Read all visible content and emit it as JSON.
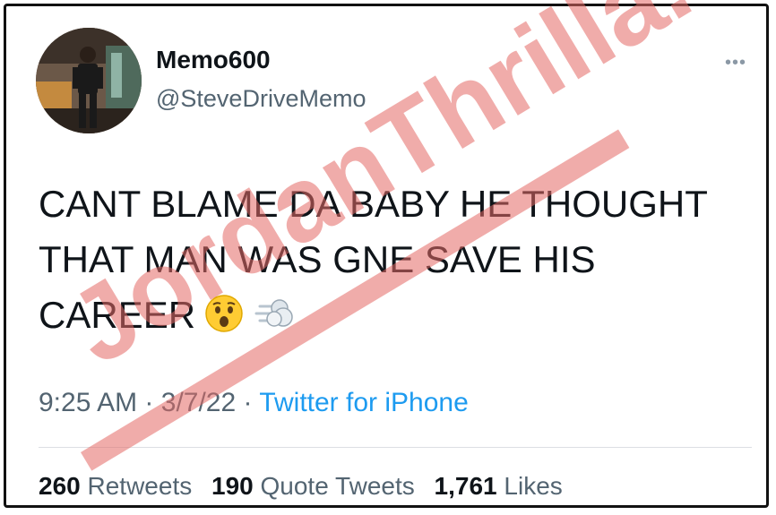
{
  "tweet": {
    "display_name": "Memo600",
    "handle": "@SteveDriveMemo",
    "more_icon": "more-horizontal-icon",
    "text_lines": [
      "CANT BLAME DA BABY HE THOUGHT",
      "THAT MAN WAS GNE SAVE HIS",
      "CAREER"
    ],
    "emojis": [
      "hushed-face-emoji",
      "dash-emoji"
    ],
    "time": "9:25 AM",
    "date": "3/7/22",
    "separator": "·",
    "source": "Twitter for iPhone"
  },
  "stats": {
    "retweets_count": "260",
    "retweets_label": "Retweets",
    "quotes_count": "190",
    "quotes_label": "Quote Tweets",
    "likes_count": "1,761",
    "likes_label": "Likes"
  },
  "watermark": {
    "text": "JordanThrilla.",
    "color": "#e46a66"
  },
  "colors": {
    "text": "#0f1419",
    "secondary": "#536471",
    "link": "#1d9bf0",
    "frame": "#111111"
  }
}
